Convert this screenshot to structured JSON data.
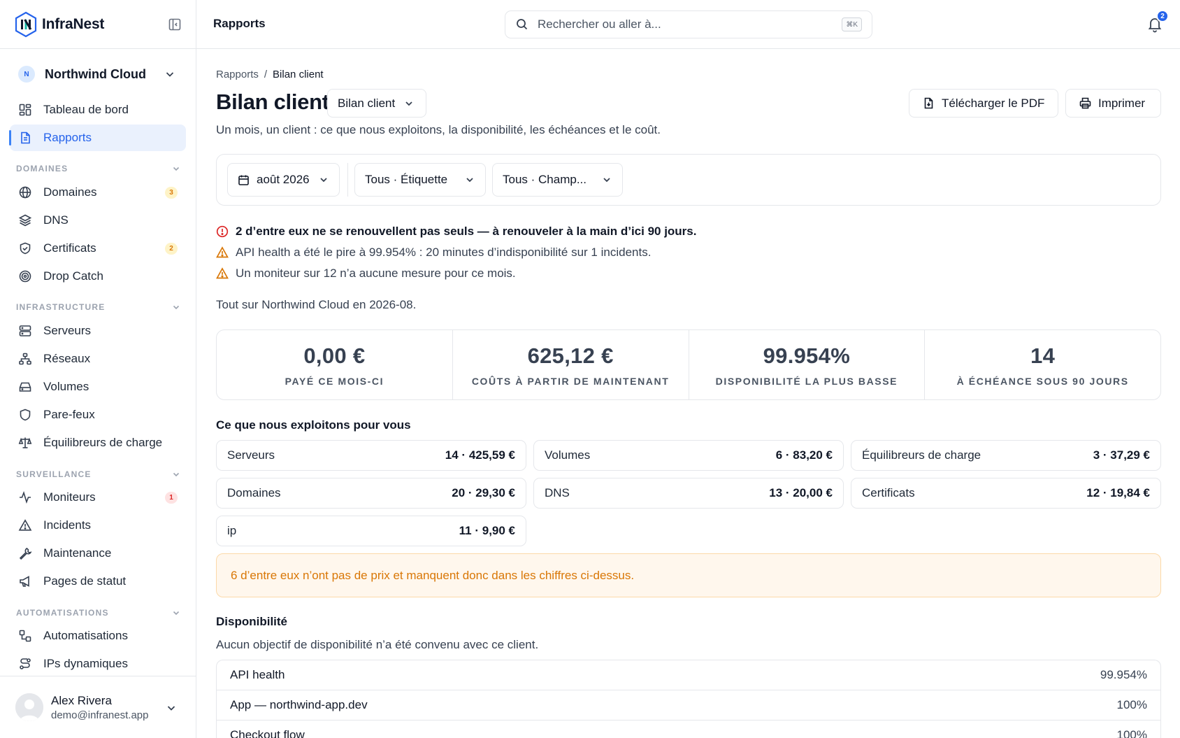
{
  "brand": {
    "name": "InfraNest"
  },
  "workspace": {
    "initial": "N",
    "name": "Northwind Cloud"
  },
  "nav": {
    "dashboard": "Tableau de bord",
    "reports": "Rapports",
    "sections": {
      "domains": "DOMAINES",
      "infrastructure": "INFRASTRUCTURE",
      "monitoring": "SURVEILLANCE",
      "automation": "AUTOMATISATIONS"
    },
    "items": {
      "domains": "Domaines",
      "dns": "DNS",
      "certificates": "Certificats",
      "dropcatch": "Drop Catch",
      "servers": "Serveurs",
      "networks": "Réseaux",
      "volumes": "Volumes",
      "firewalls": "Pare-feux",
      "loadbalancers": "Équilibreurs de charge",
      "monitors": "Moniteurs",
      "incidents": "Incidents",
      "maintenance": "Maintenance",
      "statuspages": "Pages de statut",
      "automations": "Automatisations",
      "dynips": "IPs dynamiques"
    },
    "badges": {
      "domains": "3",
      "certificates": "2",
      "monitors": "1"
    }
  },
  "user": {
    "name": "Alex Rivera",
    "email": "demo@infranest.app"
  },
  "topbar": {
    "page": "Rapports",
    "search_placeholder": "Rechercher ou aller à...",
    "search_shortcut": "⌘K",
    "notif_count": "2"
  },
  "breadcrumb": {
    "root": "Rapports",
    "sep": "/",
    "current": "Bilan client"
  },
  "header": {
    "title": "Bilan client",
    "report_select": "Bilan client",
    "subtitle": "Un mois, un client : ce que nous exploitons, la disponibilité, les échéances et le coût.",
    "download": "Télécharger le PDF",
    "print": "Imprimer"
  },
  "filters": {
    "month": "août 2026",
    "tag": "Tous · Étiquette",
    "field": "Tous · Champ..."
  },
  "alerts": [
    {
      "level": "error",
      "text": "2 d’entre eux ne se renouvellent pas seuls — à renouveler à la main d’ici 90 jours."
    },
    {
      "level": "warning",
      "text": "API health a été le pire à 99.954% : 20 minutes d’indisponibilité sur 1 incidents."
    },
    {
      "level": "warning",
      "text": "Un moniteur sur 12 n’a aucune mesure pour ce mois."
    }
  ],
  "summary": "Tout sur Northwind Cloud en 2026-08.",
  "stats": [
    {
      "value": "0,00 €",
      "label": "PAYÉ CE MOIS-CI"
    },
    {
      "value": "625,12 €",
      "label": "COÛTS À PARTIR DE MAINTENANT"
    },
    {
      "value": "99.954%",
      "label": "DISPONIBILITÉ LA PLUS BASSE"
    },
    {
      "value": "14",
      "label": "À ÉCHÉANCE SOUS 90 JOURS"
    }
  ],
  "resources": {
    "title": "Ce que nous exploitons pour vous",
    "items": [
      {
        "name": "Serveurs",
        "value": "14 · 425,59 €"
      },
      {
        "name": "Volumes",
        "value": "6 · 83,20 €"
      },
      {
        "name": "Équilibreurs de charge",
        "value": "3 · 37,29 €"
      },
      {
        "name": "Domaines",
        "value": "20 · 29,30 €"
      },
      {
        "name": "DNS",
        "value": "13 · 20,00 €"
      },
      {
        "name": "Certificats",
        "value": "12 · 19,84 €"
      },
      {
        "name": "ip",
        "value": "11 · 9,90 €"
      }
    ]
  },
  "notice": "6 d’entre eux n’ont pas de prix et manquent donc dans les chiffres ci-dessus.",
  "availability": {
    "title": "Disponibilité",
    "note": "Aucun objectif de disponibilité n’a été convenu avec ce client.",
    "rows": [
      {
        "name": "API health",
        "value": "99.954%"
      },
      {
        "name": "App — northwind-app.dev",
        "value": "100%"
      },
      {
        "name": "Checkout flow",
        "value": "100%"
      }
    ]
  },
  "colors": {
    "accent": "#2563eb",
    "warning": "#d97706",
    "danger": "#dc2626",
    "border": "#e5e7eb"
  }
}
